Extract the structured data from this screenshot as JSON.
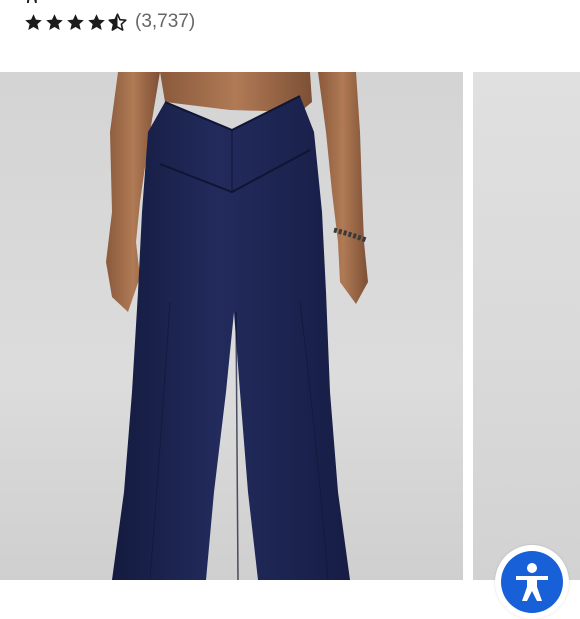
{
  "product": {
    "title_fragment": "g",
    "rating": 4.5,
    "review_count": "(3,737)"
  },
  "gallery": {
    "main_image_alt": "",
    "next_image_alt": ""
  },
  "colors": {
    "star": "#1b1b1b",
    "pants": "#1c2452",
    "accessibility_button": "#1860d8"
  },
  "icons": {
    "rating": "star-icon",
    "accessibility": "accessibility-icon"
  }
}
